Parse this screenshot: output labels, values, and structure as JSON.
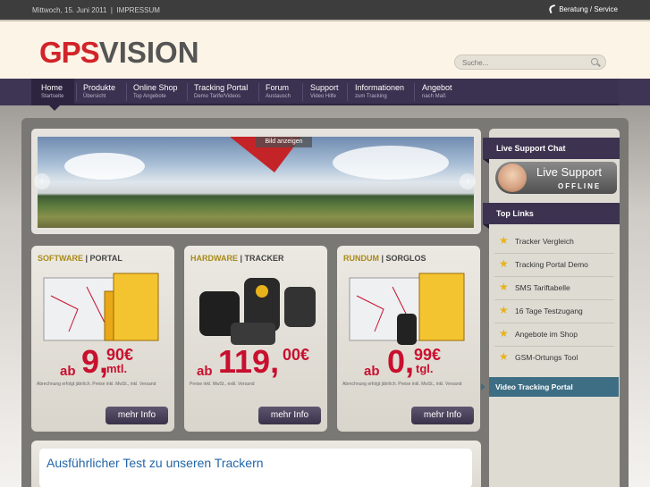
{
  "topbar": {
    "date": "Mittwoch, 15. Juni 2011",
    "sep": "|",
    "impressum": "IMPRESSUM",
    "service": "Beratung / Service"
  },
  "header": {
    "logo_a": "GPS",
    "logo_b": "VISION"
  },
  "search": {
    "placeholder": "Suche..."
  },
  "nav": [
    {
      "label": "Home",
      "sub": "Startseite"
    },
    {
      "label": "Produkte",
      "sub": "Übersicht"
    },
    {
      "label": "Online Shop",
      "sub": "Top Angebote"
    },
    {
      "label": "Tracking Portal",
      "sub": "Demo Tarife/Videos"
    },
    {
      "label": "Forum",
      "sub": "Austausch"
    },
    {
      "label": "Support",
      "sub": "Video Hilfe"
    },
    {
      "label": "Informationen",
      "sub": "zum Tracking"
    },
    {
      "label": "Angebot",
      "sub": "nach Maß"
    }
  ],
  "slider": {
    "show_image": "Bild anzeigen",
    "prev": "‹",
    "next": "›"
  },
  "boxes": [
    {
      "h1": "SOFTWARE",
      "sep": " | ",
      "h2": "PORTAL",
      "ab": "ab",
      "big": "9,",
      "sup": "90€",
      "suffix": "mtl.",
      "fine": "Abrechnung erfolgt jährlich. Preise inkl. MwSt., inkl. Versand",
      "button": "mehr Info"
    },
    {
      "h1": "HARDWARE",
      "sep": " | ",
      "h2": "TRACKER",
      "ab": "ab",
      "big": "119,",
      "sup": "00€",
      "suffix": "",
      "fine": "Preise inkl. MwSt., exkl. Versand",
      "button": "mehr Info"
    },
    {
      "h1": "RUNDUM",
      "sep": " | ",
      "h2": "SORGLOS",
      "ab": "ab",
      "big": "0,",
      "sup": "99€",
      "suffix": "tgl.",
      "fine": "Abrechnung erfolgt jährlich. Preise inkl. MwSt., inkl. Versand",
      "button": "mehr Info"
    }
  ],
  "test": {
    "title": "Ausführlicher Test zu unseren Trackern"
  },
  "sidebar": {
    "chat_title": "Live Support Chat",
    "chat_line1": "Live Support",
    "chat_line2": "OFFLINE",
    "links_title": "Top Links",
    "links": [
      "Tracker Vergleich",
      "Tracking Portal Demo",
      "SMS Tariftabelle",
      "16 Tage Testzugang",
      "Angebote im Shop",
      "GSM-Ortungs Tool"
    ],
    "video_title": "Video Tracking Portal"
  },
  "colors": {
    "brand_red": "#d2232a",
    "nav_bg": "#3b3150",
    "link_blue": "#2466a8",
    "video_bar": "#3e6e84"
  }
}
